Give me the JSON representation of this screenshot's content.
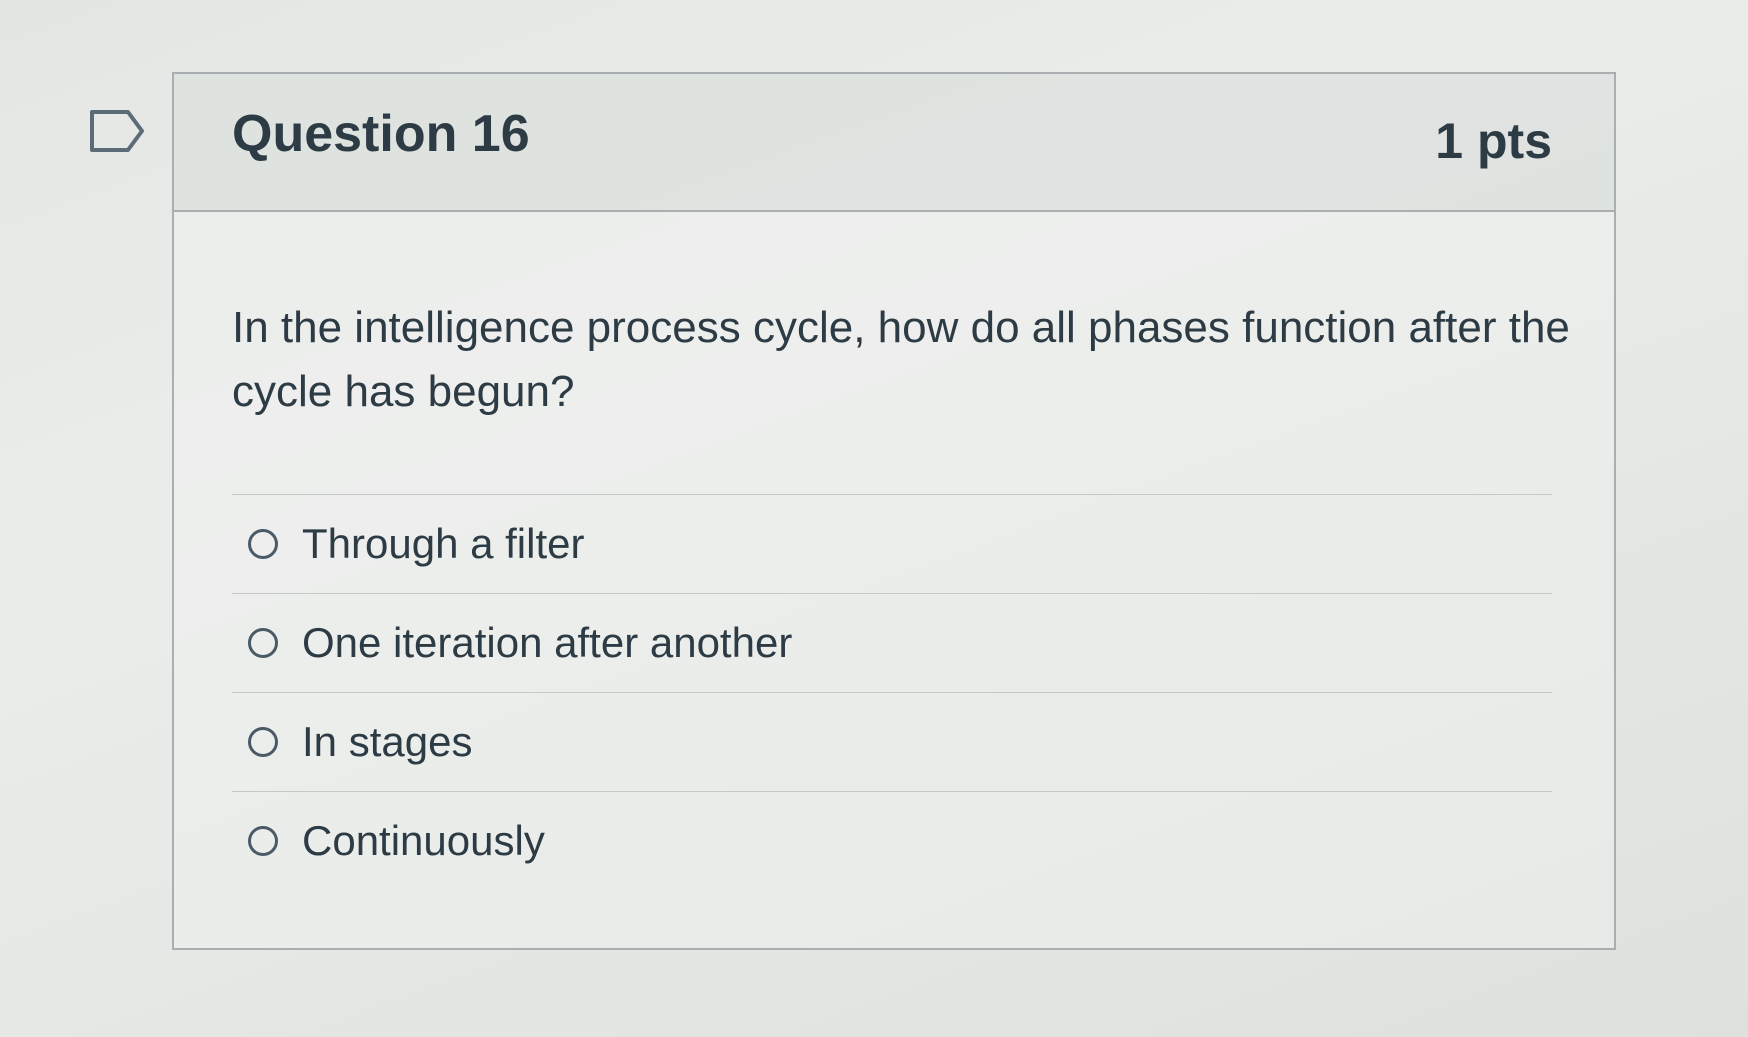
{
  "question": {
    "title": "Question 16",
    "points": "1 pts",
    "text": "In the intelligence process cycle, how do all phases function after the cycle has begun?",
    "flag_icon": "flag-question-icon",
    "answers": [
      {
        "label": "Through a filter",
        "selected": false
      },
      {
        "label": "One iteration after another",
        "selected": false
      },
      {
        "label": "In stages",
        "selected": false
      },
      {
        "label": "Continuously",
        "selected": false
      }
    ]
  },
  "colors": {
    "text": "#2d3b45",
    "border": "#a9aeb1",
    "header_bg": "#dde0de"
  }
}
